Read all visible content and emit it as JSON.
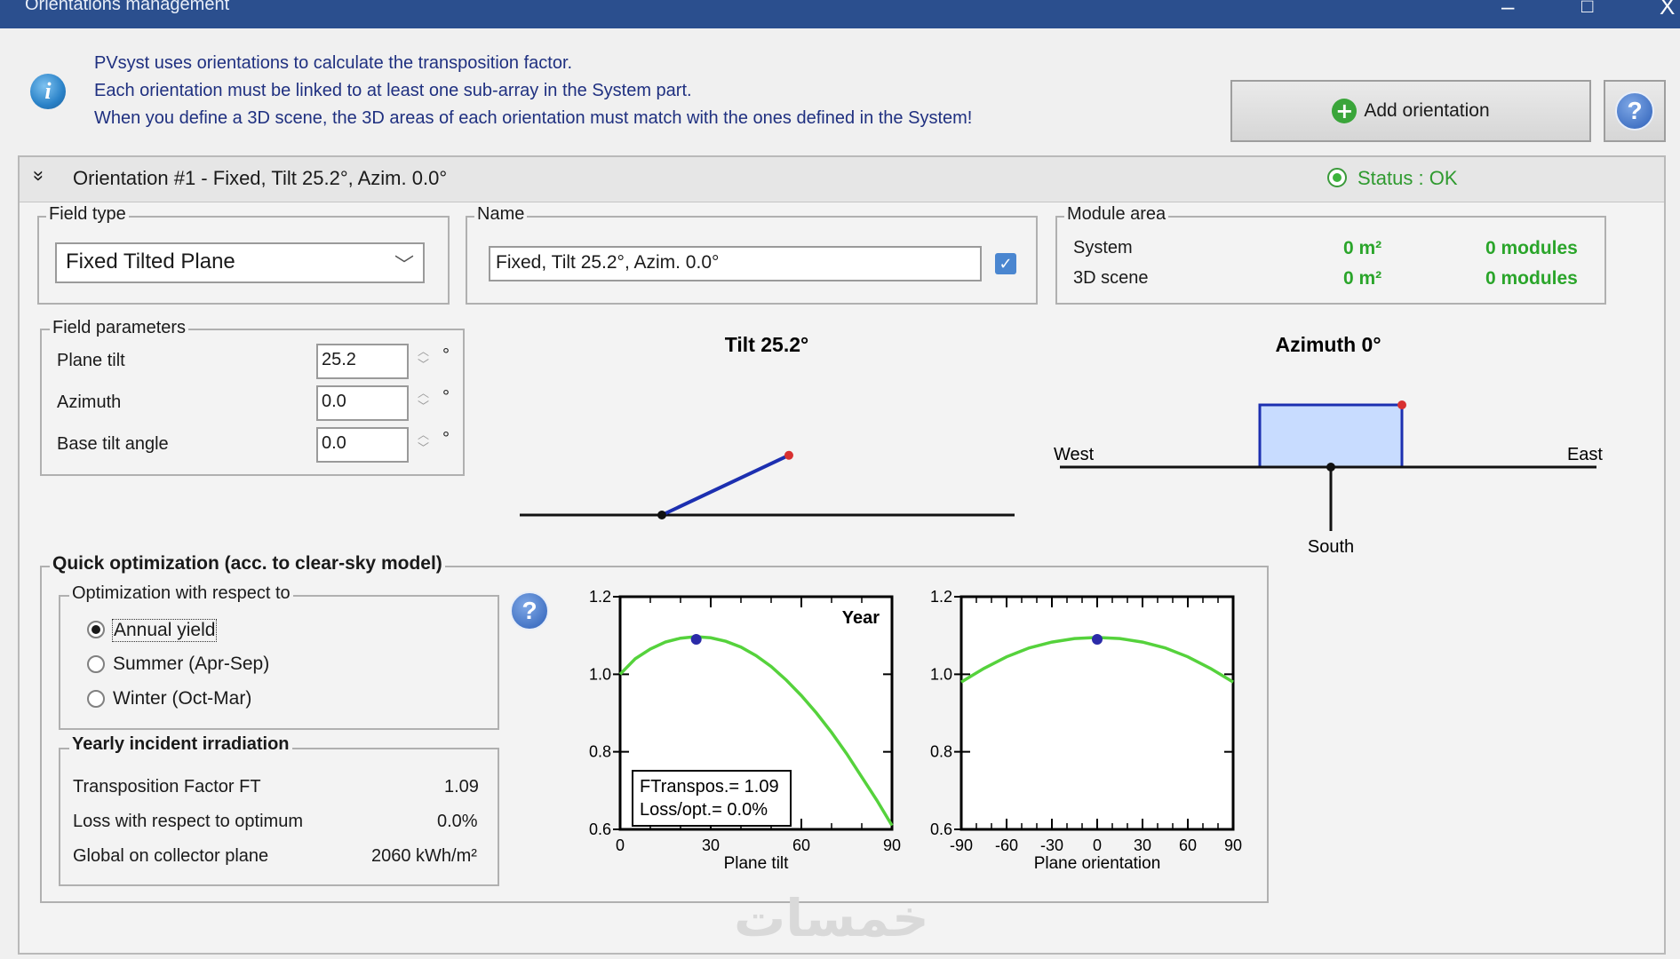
{
  "window": {
    "title": "Orientations management",
    "minimize": "–",
    "maximize": "□",
    "close": "X"
  },
  "info": {
    "lines": [
      "PVsyst uses orientations to calculate the transposition factor.",
      "Each orientation must be linked to at least one sub-array in the System part.",
      "When you define a 3D scene, the 3D areas of each orientation must match with the ones defined in the System!"
    ]
  },
  "toolbar": {
    "add_orientation_label": "Add orientation",
    "help_label": "?"
  },
  "orientation": {
    "title": "Orientation #1 - Fixed, Tilt 25.2°, Azim. 0.0°",
    "collapse_glyph": "»",
    "status": "Status : OK",
    "field_type": {
      "legend": "Field type",
      "value": "Fixed Tilted Plane"
    },
    "name": {
      "legend": "Name",
      "value": "Fixed, Tilt 25.2°, Azim. 0.0°"
    },
    "module_area": {
      "legend": "Module area",
      "rows": [
        {
          "label": "System",
          "area": "0 m²",
          "modules": "0 modules"
        },
        {
          "label": "3D scene",
          "area": "0 m²",
          "modules": "0 modules"
        }
      ]
    },
    "field_parameters": {
      "legend": "Field parameters",
      "rows": [
        {
          "label": "Plane tilt",
          "value": "25.2",
          "unit": "°"
        },
        {
          "label": "Azimuth",
          "value": "0.0",
          "unit": "°"
        },
        {
          "label": "Base tilt angle",
          "value": "0.0",
          "unit": "°"
        }
      ]
    },
    "tilt_diagram": {
      "title": "Tilt 25.2°",
      "tilt_deg": 25.2
    },
    "azimuth_diagram": {
      "title": "Azimuth 0°",
      "west": "West",
      "east": "East",
      "south": "South",
      "azimuth_deg": 0
    }
  },
  "quick_opt": {
    "title": "Quick optimization (acc. to clear-sky model)",
    "respect_legend": "Optimization with respect to",
    "options": [
      "Annual yield",
      "Summer (Apr-Sep)",
      "Winter (Oct-Mar)"
    ],
    "selected_index": 0,
    "yearly": {
      "legend": "Yearly incident irradiation",
      "rows": [
        {
          "label": "Transposition Factor FT",
          "value": "1.09"
        },
        {
          "label": "Loss with respect to optimum",
          "value": "0.0%"
        },
        {
          "label": "Global on collector plane",
          "value": "2060 kWh/m²"
        }
      ]
    }
  },
  "chart_data": [
    {
      "type": "line",
      "title": "Year",
      "xlabel": "Plane tilt",
      "ylabel": "",
      "xlim": [
        0,
        90
      ],
      "ylim": [
        0.6,
        1.2
      ],
      "xticks": [
        0,
        30,
        60,
        90
      ],
      "yticks": [
        0.6,
        0.8,
        1.0,
        1.2
      ],
      "ytick_labels": [
        "0.6",
        "0.8",
        "1.0",
        "1.2"
      ],
      "x": [
        0,
        5,
        10,
        15,
        20,
        25,
        30,
        35,
        40,
        45,
        50,
        55,
        60,
        65,
        70,
        75,
        80,
        85,
        90
      ],
      "y": [
        1.0,
        1.04,
        1.065,
        1.083,
        1.093,
        1.097,
        1.094,
        1.085,
        1.07,
        1.048,
        1.02,
        0.985,
        0.945,
        0.9,
        0.85,
        0.795,
        0.735,
        0.675,
        0.61
      ],
      "marker": {
        "x": 25.2,
        "y": 1.09
      },
      "annotation": [
        "FTranspos.= 1.09",
        "Loss/opt.= 0.0%"
      ],
      "line_color": "#55d23c",
      "marker_color": "#2b2ba8"
    },
    {
      "type": "line",
      "title": "",
      "xlabel": "Plane orientation",
      "ylabel": "",
      "xlim": [
        -90,
        90
      ],
      "ylim": [
        0.6,
        1.2
      ],
      "xticks": [
        -90,
        -60,
        -30,
        0,
        30,
        60,
        90
      ],
      "yticks": [
        0.6,
        0.8,
        1.0,
        1.2
      ],
      "ytick_labels": [
        "0.6",
        "0.8",
        "1.0",
        "1.2"
      ],
      "x": [
        -90,
        -75,
        -60,
        -45,
        -30,
        -15,
        0,
        15,
        30,
        45,
        60,
        75,
        90
      ],
      "y": [
        0.98,
        1.015,
        1.045,
        1.068,
        1.083,
        1.092,
        1.095,
        1.092,
        1.083,
        1.068,
        1.045,
        1.015,
        0.98
      ],
      "marker": {
        "x": 0,
        "y": 1.09
      },
      "line_color": "#55d23c",
      "marker_color": "#2b2ba8"
    }
  ],
  "watermark": "خمسات"
}
